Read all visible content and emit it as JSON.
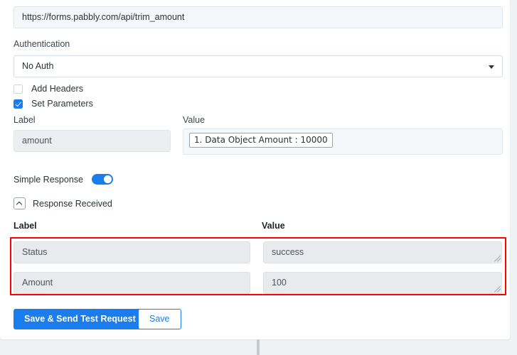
{
  "request": {
    "url_value": "https://forms.pabbly.com/api/trim_amount",
    "url_placeholder": "https://",
    "authentication_label": "Authentication",
    "authentication_value": "No Auth",
    "authentication_options": [
      "No Auth"
    ]
  },
  "options": {
    "add_headers_label": "Add Headers",
    "add_headers_checked": false,
    "set_parameters_label": "Set Parameters",
    "set_parameters_checked": true
  },
  "parameters": {
    "label_header": "Label",
    "value_header": "Value",
    "rows": [
      {
        "label": "amount",
        "value_token": "1. Data Object Amount : 10000"
      }
    ]
  },
  "simple_response": {
    "label": "Simple Response",
    "enabled": true
  },
  "response": {
    "section_title": "Response Received",
    "collapsed": false,
    "label_header": "Label",
    "value_header": "Value",
    "rows": [
      {
        "label": "Status",
        "value": "success"
      },
      {
        "label": "Amount",
        "value": "100"
      }
    ],
    "highlight_color": "#fe0000"
  },
  "actions": {
    "primary_label": "Save & Send Test Request",
    "secondary_label": "Save",
    "accent_color": "#1b7ced"
  }
}
